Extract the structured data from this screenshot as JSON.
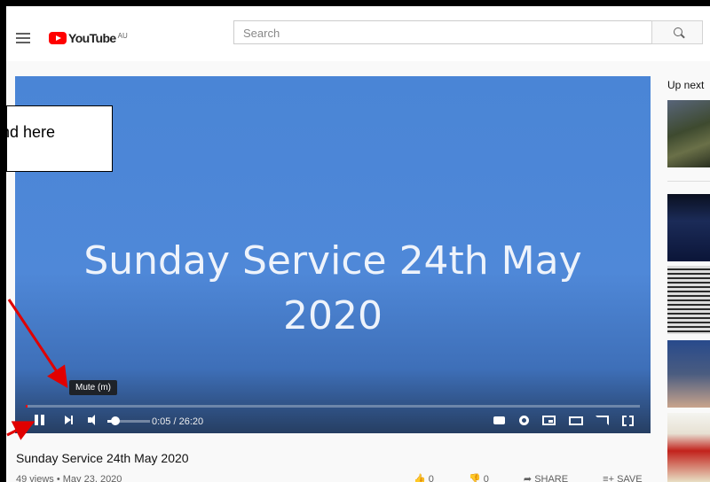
{
  "header": {
    "logo_text": "YouTube",
    "country_code": "AU",
    "search_placeholder": "Search"
  },
  "player": {
    "slide_line1": "Sunday Service 24th May",
    "slide_line2": "2020",
    "progress_fraction": 0.003,
    "volume_fraction": 0.12,
    "time_display": "0:05 / 26:20",
    "tooltip": "Mute (m)"
  },
  "annotation": {
    "callout_text": "nd here"
  },
  "video_info": {
    "title": "Sunday Service 24th May 2020",
    "views_date": "49 views • May 23, 2020",
    "like_count": "0",
    "dislike_count": "0",
    "share_label": "SHARE",
    "save_label": "SAVE"
  },
  "sidebar": {
    "up_next_label": "Up next"
  }
}
